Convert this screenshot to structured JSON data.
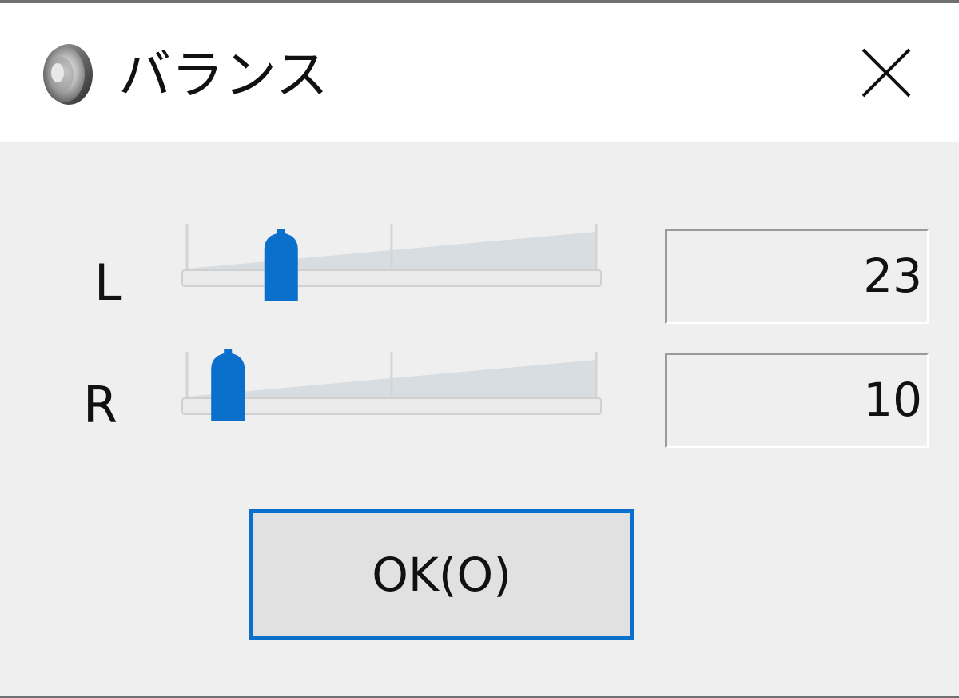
{
  "dialog": {
    "title": "バランス",
    "icon": "speaker-icon",
    "close_icon": "close-icon"
  },
  "channels": [
    {
      "label": "L",
      "value": "23",
      "slider_level": 0.23
    },
    {
      "label": "R",
      "value": "10",
      "slider_level": 0.1
    }
  ],
  "buttons": {
    "ok_label": "OK(O)"
  },
  "colors": {
    "accent": "#0a70cc",
    "titlebar_bg": "#ffffff",
    "client_bg": "#efefef",
    "track_fill": "#d8dde2",
    "thumb": "#0a70cc"
  }
}
